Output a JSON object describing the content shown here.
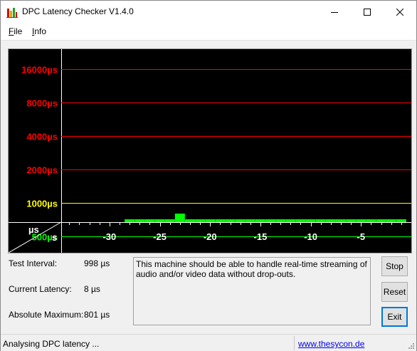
{
  "window": {
    "title": "DPC Latency Checker V1.4.0",
    "minimize_icon": "minimize-icon",
    "maximize_icon": "maximize-icon",
    "close_icon": "close-icon"
  },
  "menu": {
    "items": [
      {
        "label_first": "F",
        "label_rest": "ile"
      },
      {
        "label_first": "I",
        "label_rest": "nfo"
      }
    ]
  },
  "chart_data": {
    "type": "bar",
    "y_scale": "log",
    "y_ticks": [
      {
        "label": "16000µs",
        "value": 16000,
        "color": "#ff0000"
      },
      {
        "label": "8000µs",
        "value": 8000,
        "color": "#ff0000"
      },
      {
        "label": "4000µs",
        "value": 4000,
        "color": "#ff0000"
      },
      {
        "label": "2000µs",
        "value": 2000,
        "color": "#ff0000"
      },
      {
        "label": "1000µs",
        "value": 1000,
        "color": "#ffff00"
      },
      {
        "label": "500µs",
        "value": 500,
        "color": "#00ff00"
      }
    ],
    "x_ticks": [
      "-30",
      "-25",
      "-20",
      "-15",
      "-10",
      "-5"
    ],
    "x_tick_values": [
      -30,
      -25,
      -20,
      -15,
      -10,
      -5
    ],
    "corner_label_top": "µs",
    "corner_label_bottom": "s",
    "xlim": [
      -34.8,
      0
    ],
    "x": [
      -28,
      -27,
      -26,
      -25,
      -24,
      -23,
      -22,
      -21,
      -20,
      -19,
      -18,
      -17,
      -16,
      -15,
      -14,
      -13,
      -12,
      -11,
      -10,
      -9,
      -8,
      -7,
      -6,
      -5,
      -4,
      -3,
      -2,
      -1
    ],
    "values": [
      12,
      14,
      14,
      13,
      12,
      801,
      13,
      13,
      12,
      12,
      11,
      11,
      11,
      11,
      11,
      11,
      11,
      14,
      12,
      12,
      11,
      12,
      13,
      13,
      12,
      11,
      12,
      12
    ],
    "bar_color": "#00ff00"
  },
  "stats": {
    "test_interval_label": "Test Interval:",
    "test_interval_value": "998 µs",
    "current_latency_label": "Current Latency:",
    "current_latency_value": "8 µs",
    "absolute_maximum_label": "Absolute Maximum:",
    "absolute_maximum_value": "801 µs"
  },
  "message": "This machine should be able to handle real-time streaming of audio and/or video data without drop-outs.",
  "buttons": {
    "stop": "Stop",
    "reset": "Reset",
    "exit": "Exit"
  },
  "status": {
    "text": "Analysing DPC latency ...",
    "link": "www.thesycon.de"
  }
}
